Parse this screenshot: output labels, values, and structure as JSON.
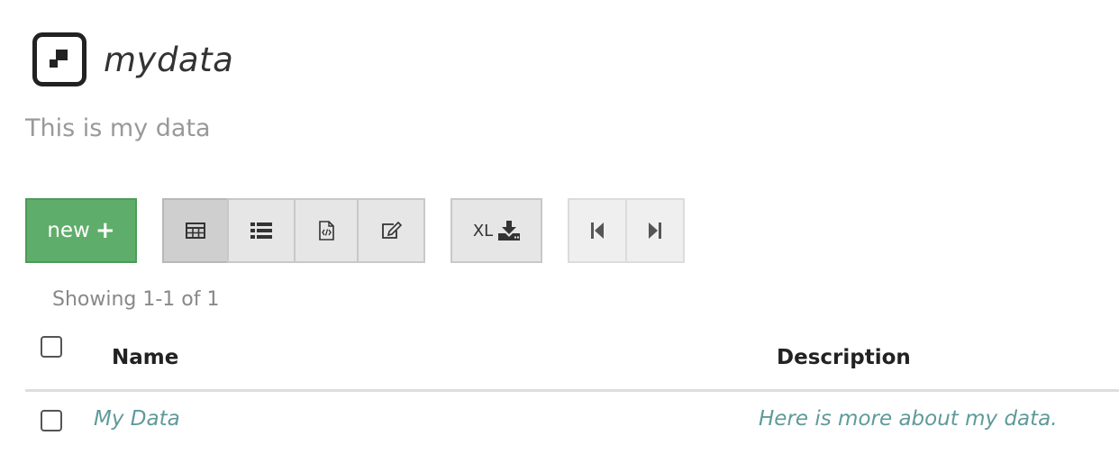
{
  "header": {
    "title": "mydata",
    "subtitle": "This is my data"
  },
  "toolbar": {
    "new_label": "new",
    "new_icon": "+",
    "view_buttons": [
      {
        "name": "table-view",
        "icon": "table-icon",
        "active": true
      },
      {
        "name": "list-view",
        "icon": "list-icon",
        "active": false
      },
      {
        "name": "code-view",
        "icon": "code-file-icon",
        "active": false
      },
      {
        "name": "edit-view",
        "icon": "edit-icon",
        "active": false
      }
    ],
    "export_label": "XL",
    "export_icon": "download-icon",
    "pager_icons": [
      "first-page-icon",
      "last-page-icon"
    ]
  },
  "table": {
    "showing": "Showing 1-1 of 1",
    "columns": [
      "Name",
      "Description"
    ],
    "rows": [
      {
        "name": "My Data",
        "description": "Here is more about my data."
      }
    ]
  },
  "colors": {
    "new_button": "#5fad6a",
    "link_text": "#5f9a9a",
    "muted_text": "#999999"
  }
}
